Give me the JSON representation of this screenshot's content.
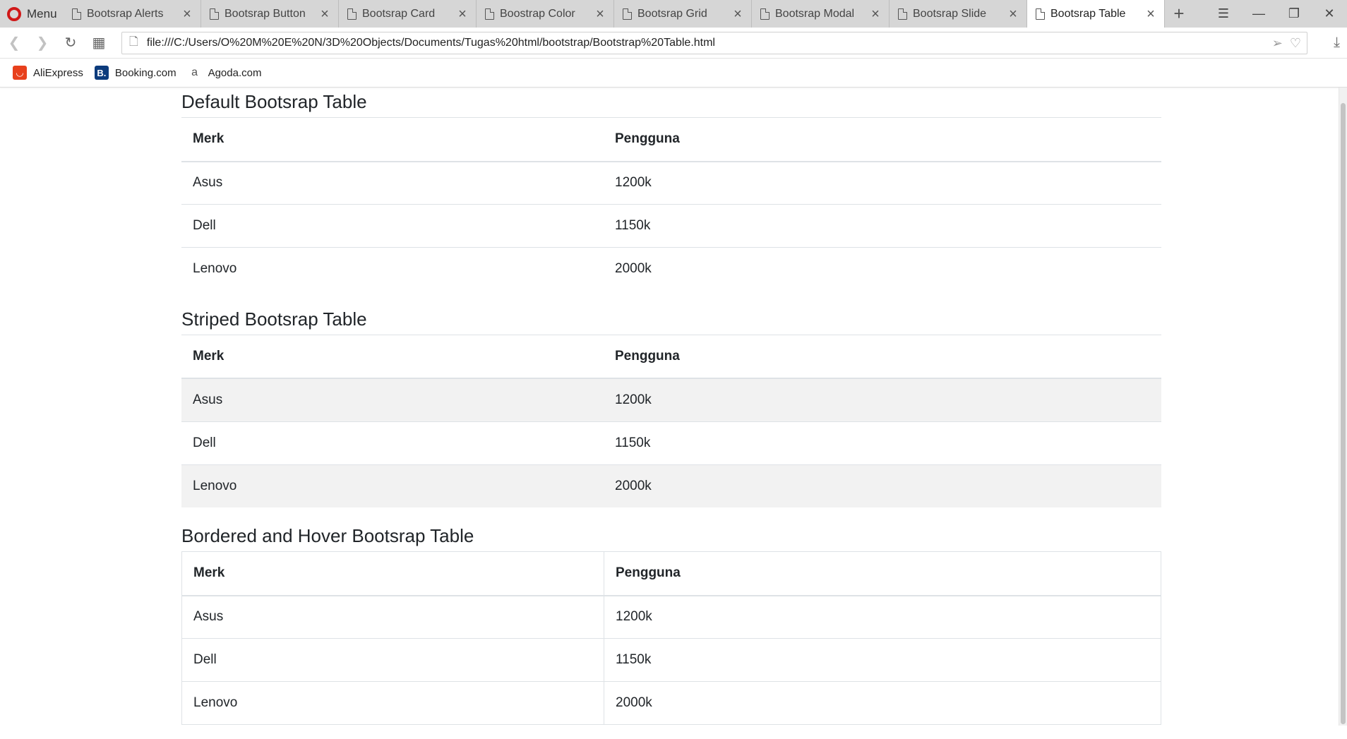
{
  "browser": {
    "menu_label": "Menu",
    "tabs": [
      {
        "label": "Bootsrap Alerts",
        "active": false
      },
      {
        "label": "Bootsrap Button",
        "active": false
      },
      {
        "label": "Bootsrap Card",
        "active": false
      },
      {
        "label": "Boostrap Color",
        "active": false
      },
      {
        "label": "Bootsrap Grid",
        "active": false
      },
      {
        "label": "Bootsrap Modal",
        "active": false
      },
      {
        "label": "Bootsrap Slide",
        "active": false
      },
      {
        "label": "Bootsrap Table",
        "active": true
      }
    ],
    "url": "file:///C:/Users/O%20M%20E%20N/3D%20Objects/Documents/Tugas%20html/bootstrap/Bootstrap%20Table.html",
    "bookmarks": [
      {
        "label": "AliExpress",
        "icon": "aliexpress-icon"
      },
      {
        "label": "Booking.com",
        "icon": "booking-icon"
      },
      {
        "label": "Agoda.com",
        "icon": "agoda-icon"
      }
    ]
  },
  "page": {
    "tables": [
      {
        "title": "Default Bootsrap Table",
        "headers": [
          "Merk",
          "Pengguna"
        ],
        "rows": [
          [
            "Asus",
            "1200k"
          ],
          [
            "Dell",
            "1150k"
          ],
          [
            "Lenovo",
            "2000k"
          ]
        ]
      },
      {
        "title": "Striped Bootsrap Table",
        "headers": [
          "Merk",
          "Pengguna"
        ],
        "rows": [
          [
            "Asus",
            "1200k"
          ],
          [
            "Dell",
            "1150k"
          ],
          [
            "Lenovo",
            "2000k"
          ]
        ]
      },
      {
        "title": "Bordered and Hover Bootsrap Table",
        "headers": [
          "Merk",
          "Pengguna"
        ],
        "rows": [
          [
            "Asus",
            "1200k"
          ],
          [
            "Dell",
            "1150k"
          ],
          [
            "Lenovo",
            "2000k"
          ]
        ]
      }
    ]
  }
}
